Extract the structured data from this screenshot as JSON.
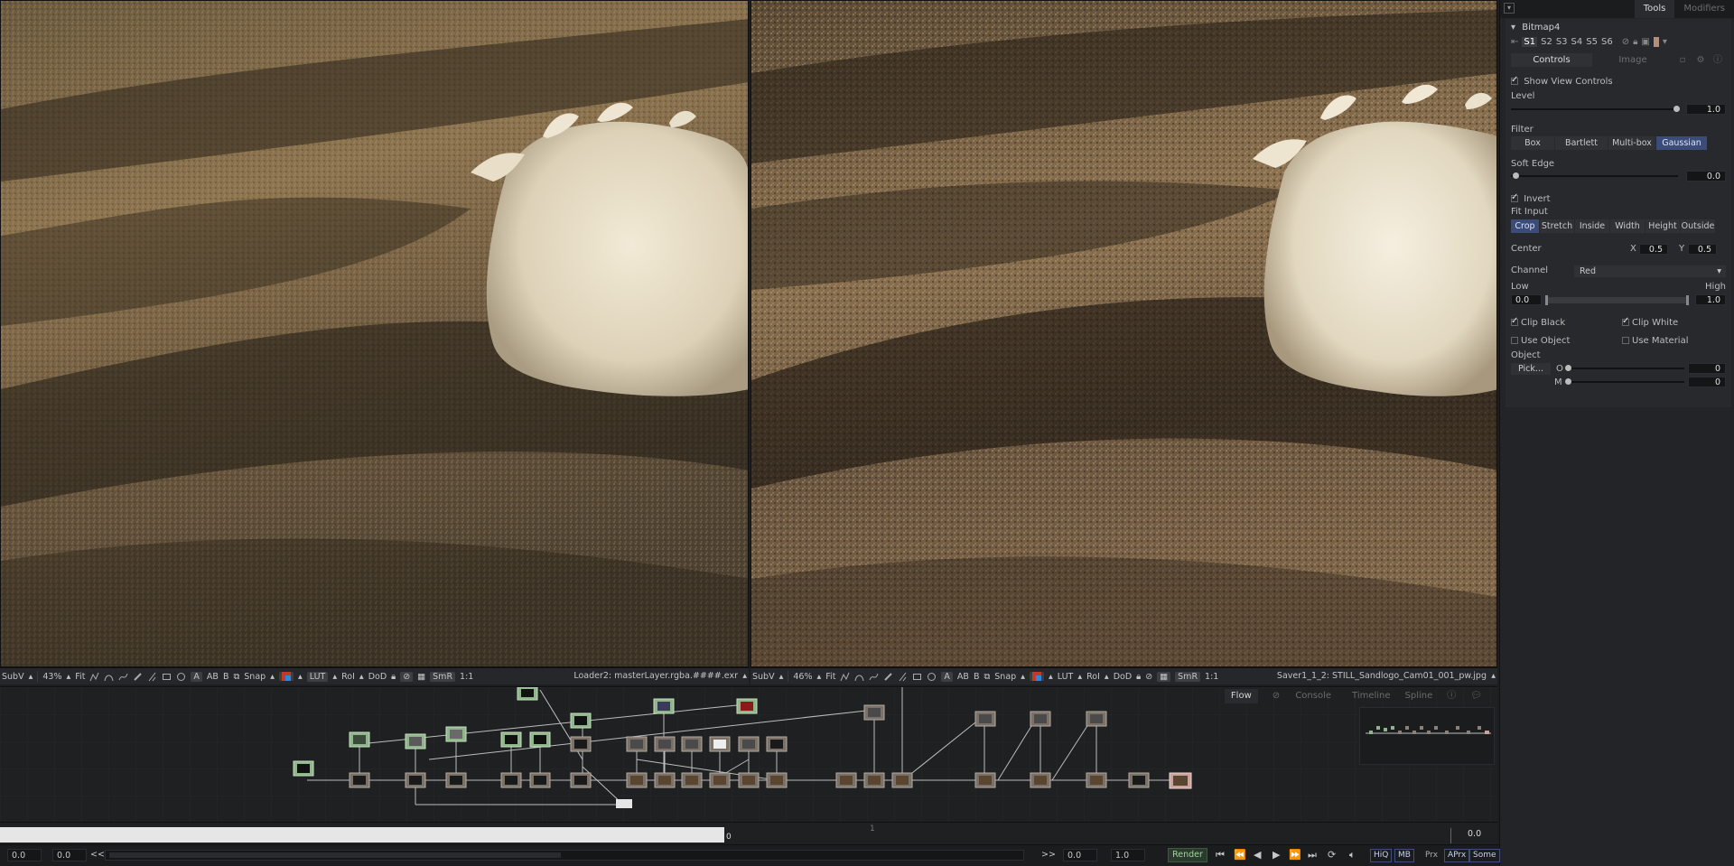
{
  "panel": {
    "tabs": [
      "Tools",
      "Modifiers"
    ],
    "tool_name": "Bitmap4",
    "slots": [
      "S1",
      "S2",
      "S3",
      "S4",
      "S5",
      "S6"
    ],
    "subtabs": [
      "Controls",
      "Image"
    ],
    "show_view_controls": "Show View Controls",
    "level_label": "Level",
    "level_value": "1.0",
    "filter_label": "Filter",
    "filter_options": [
      "Box",
      "Bartlett",
      "Multi-box",
      "Gaussian"
    ],
    "filter_selected": "Gaussian",
    "soft_edge_label": "Soft Edge",
    "soft_edge_value": "0.0",
    "invert_label": "Invert",
    "fit_input_label": "Fit Input",
    "fit_options": [
      "Crop",
      "Stretch",
      "Inside",
      "Width",
      "Height",
      "Outside"
    ],
    "fit_selected": "Crop",
    "center_label": "Center",
    "center_x_label": "X",
    "center_x": "0.5",
    "center_y_label": "Y",
    "center_y": "0.5",
    "channel_label": "Channel",
    "channel_value": "Red",
    "low_label": "Low",
    "high_label": "High",
    "low_value": "0.0",
    "high_value": "1.0",
    "clip_black": "Clip Black",
    "clip_white": "Clip White",
    "use_object": "Use Object",
    "use_material": "Use Material",
    "object_label": "Object",
    "pick_button": "Pick...",
    "o_label": "O",
    "o_value": "0",
    "m_label": "M",
    "m_value": "0"
  },
  "viewer_left": {
    "subv": "SubV",
    "zoom": "43%",
    "fit": "Fit",
    "snap": "Snap",
    "lut": "LUT",
    "roi": "RoI",
    "dod": "DoD",
    "smr": "SmR",
    "ratio": "1:1",
    "filename": "Loader2: masterLayer.rgba.####.exr",
    "letters": [
      "A",
      "B"
    ]
  },
  "viewer_right": {
    "subv": "SubV",
    "zoom": "46%",
    "fit": "Fit",
    "snap": "Snap",
    "lut": "LUT",
    "roi": "RoI",
    "dod": "DoD",
    "smr": "SmR",
    "ratio": "1:1",
    "filename": "Saver1_1_2: STILL_Sandlogo_Cam01_001_pw.jpg",
    "letters": [
      "A",
      "B"
    ]
  },
  "flow": {
    "tabs": [
      "Flow",
      "Console",
      "Timeline",
      "Spline"
    ],
    "active_tab": "Flow"
  },
  "ruler": {
    "marker_left": "0",
    "marker_mid": "1",
    "value_right": "0.0"
  },
  "transport": {
    "global_start": "0.0",
    "render_start": "0.0",
    "prev_glyph": "<<",
    "next_glyph": ">>",
    "render_end": "0.0",
    "global_end": "1.0",
    "render_button": "Render",
    "buttons": [
      "HiQ",
      "MB",
      "Prx",
      "APrx",
      "Some"
    ]
  },
  "colors": {
    "accent_blue": "#3c4c78",
    "render_green": "#9fd59a",
    "node_green": "#8fb58a",
    "node_pink": "#c9a39d"
  }
}
